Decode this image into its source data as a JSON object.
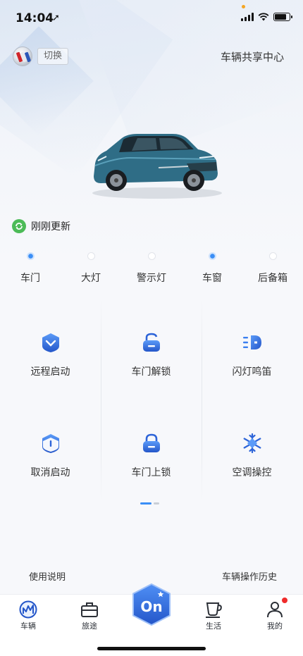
{
  "status_bar": {
    "time": "14:04",
    "location_glyph": "➚"
  },
  "header": {
    "brand_logo": "buick-logo",
    "switch_label": "切换",
    "share_center_label": "车辆共享中心"
  },
  "vehicle": {
    "image": "blue-buick-wagon"
  },
  "refresh": {
    "text": "刚刚更新",
    "icon": "refresh-icon",
    "color": "#4cbb57"
  },
  "status_items": [
    {
      "label": "车门",
      "active": true
    },
    {
      "label": "大灯",
      "active": false
    },
    {
      "label": "警示灯",
      "active": false
    },
    {
      "label": "车窗",
      "active": true
    },
    {
      "label": "后备箱",
      "active": false
    }
  ],
  "controls": [
    {
      "label": "远程启动",
      "icon": "remote-start-icon"
    },
    {
      "label": "车门解锁",
      "icon": "unlock-icon"
    },
    {
      "label": "闪灯鸣笛",
      "icon": "flash-horn-icon"
    },
    {
      "label": "取消启动",
      "icon": "cancel-start-icon"
    },
    {
      "label": "车门上锁",
      "icon": "lock-icon"
    },
    {
      "label": "空调操控",
      "icon": "climate-snowflake-icon"
    }
  ],
  "pager": {
    "current_page": 1,
    "total_pages": 2
  },
  "links": {
    "instructions": "使用说明",
    "history": "车辆操作历史"
  },
  "tabbar": {
    "tabs": [
      {
        "label": "车辆",
        "icon": "car-tab-icon"
      },
      {
        "label": "旅途",
        "icon": "briefcase-icon"
      },
      {
        "label": "",
        "icon": "onstar-button"
      },
      {
        "label": "生活",
        "icon": "coffee-cup-icon"
      },
      {
        "label": "我的",
        "icon": "user-icon"
      }
    ],
    "center_label": "On",
    "notification_dot": true
  },
  "colors": {
    "accent": "#3a7ff0",
    "accent_dark": "#2456c9",
    "active_dot": "#3a8ef6",
    "notification": "#ef2b2b"
  }
}
